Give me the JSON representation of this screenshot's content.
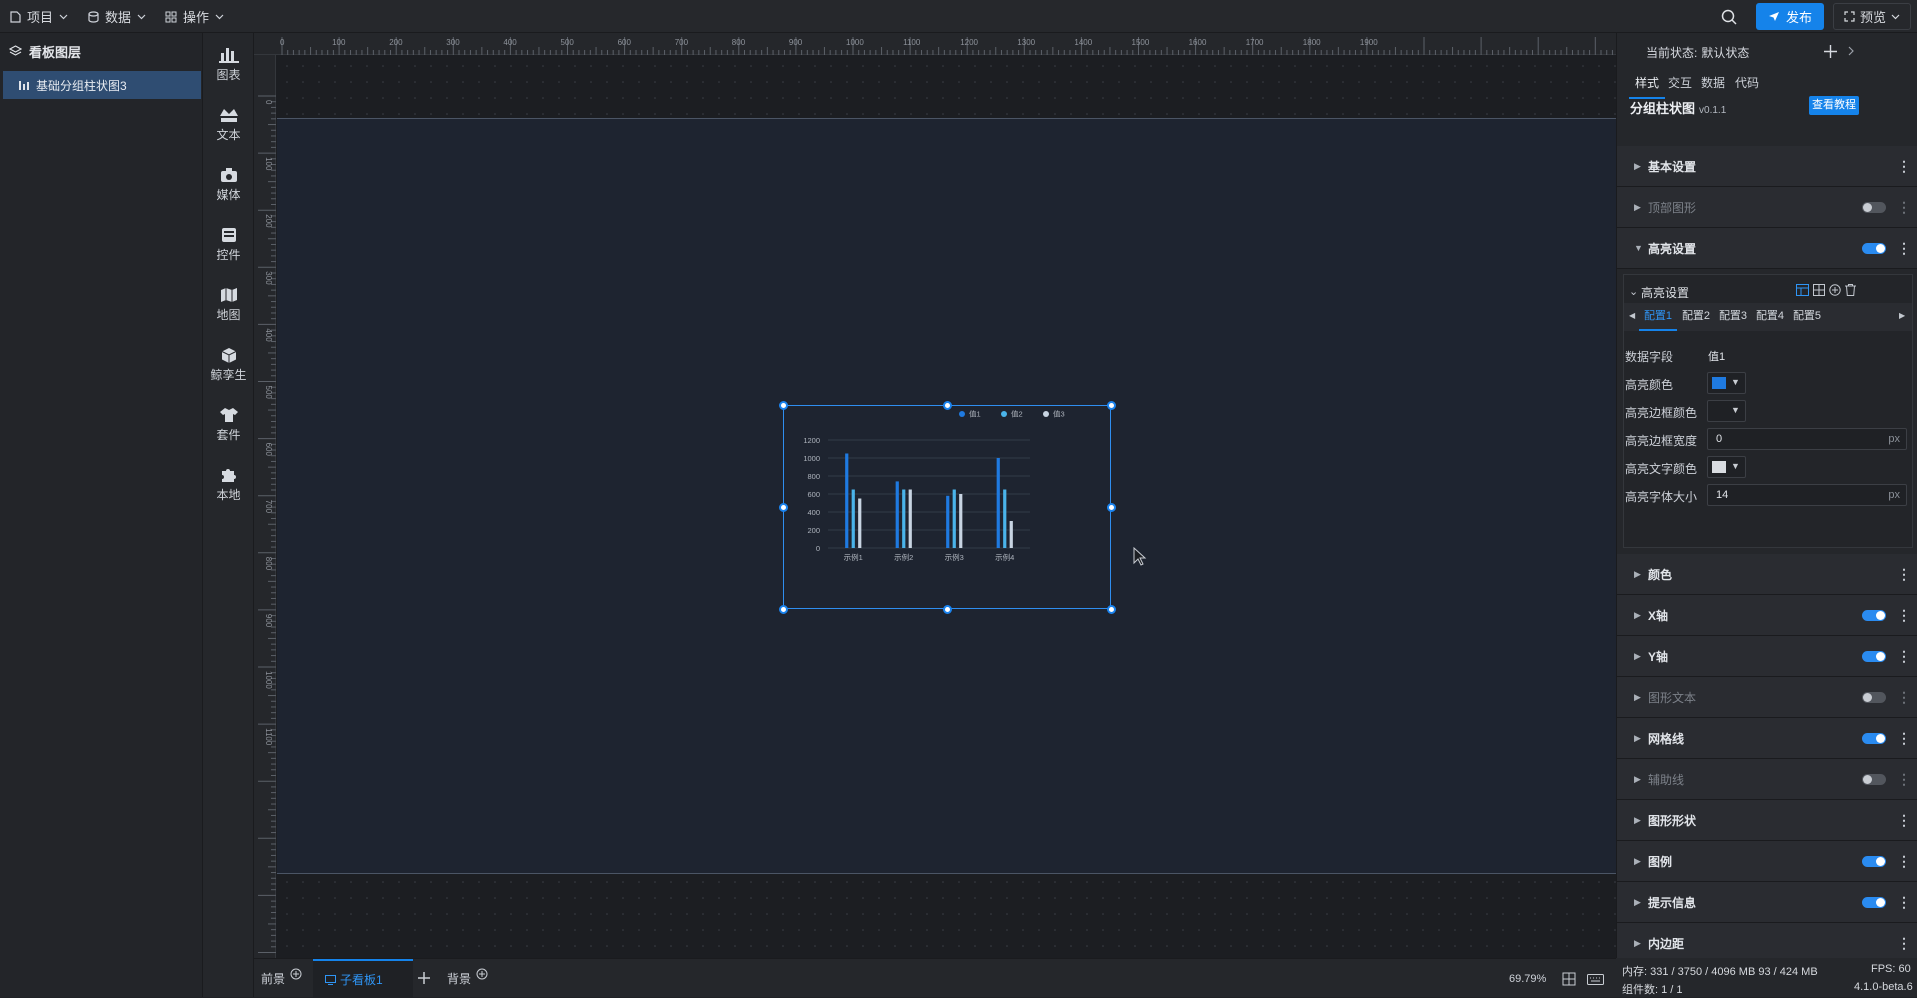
{
  "topbar": {
    "menus": [
      {
        "label": "项目",
        "icon": "file-icon"
      },
      {
        "label": "数据",
        "icon": "database-icon"
      },
      {
        "label": "操作",
        "icon": "grid-icon"
      }
    ],
    "publish_label": "发布",
    "preview_label": "预览"
  },
  "layers": {
    "title": "看板图层",
    "item": "基础分组柱状图3"
  },
  "components": [
    "图表",
    "文本",
    "媒体",
    "控件",
    "地图",
    "鲸孪生",
    "套件",
    "本地"
  ],
  "ruler": {
    "top": [
      "0",
      "100",
      "200",
      "300",
      "400",
      "500",
      "600",
      "700",
      "800",
      "900",
      "1000",
      "1100",
      "1200",
      "1300",
      "1400",
      "1500",
      "1600",
      "1700",
      "1800",
      "1900"
    ],
    "left": [
      "0",
      "100",
      "200",
      "300",
      "400",
      "500",
      "600",
      "700",
      "800",
      "900",
      "1000",
      "1100"
    ]
  },
  "chart_data": {
    "type": "bar",
    "categories": [
      "示例1",
      "示例2",
      "示例3",
      "示例4"
    ],
    "series": [
      {
        "name": "值1",
        "values": [
          1050,
          740,
          580,
          1000
        ],
        "color": "#1f7ae0"
      },
      {
        "name": "值2",
        "values": [
          650,
          650,
          650,
          650
        ],
        "color": "#4ab4ea"
      },
      {
        "name": "值3",
        "values": [
          550,
          650,
          600,
          300
        ],
        "color": "#c8d4e2"
      }
    ],
    "yticks": [
      "0",
      "200",
      "400",
      "600",
      "800",
      "1000",
      "1200"
    ],
    "ylim": [
      0,
      1200
    ],
    "legend": "top-right",
    "grid": true
  },
  "bottom": {
    "tab_front": "前景",
    "tab_board": "子看板1",
    "tab_back": "背景",
    "zoom": "69.79%"
  },
  "panel": {
    "state_label": "当前状态:",
    "state_value": "默认状态",
    "tabs": [
      "样式",
      "交互",
      "数据",
      "代码"
    ],
    "component_name": "分组柱状图",
    "version": "v0.1.1",
    "tutorial_button": "查看教程",
    "sections_top": [
      {
        "label": "基本设置",
        "toggle": null,
        "dim": false,
        "open": false
      },
      {
        "label": "顶部图形",
        "toggle": false,
        "dim": true,
        "open": false
      },
      {
        "label": "高亮设置",
        "toggle": true,
        "dim": false,
        "open": true
      }
    ],
    "highlight": {
      "title": "高亮设置",
      "configs": [
        "配置1",
        "配置2",
        "配置3",
        "配置4",
        "配置5"
      ],
      "fields": {
        "data_field_label": "数据字段",
        "data_field_value": "值1",
        "color_label": "高亮颜色",
        "color_value": "#1f7ae0",
        "border_color_label": "高亮边框颜色",
        "border_width_label": "高亮边框宽度",
        "border_width_value": "0",
        "text_color_label": "高亮文字颜色",
        "text_color_value": "#d9dce1",
        "font_size_label": "高亮字体大小",
        "font_size_value": "14",
        "unit": "px"
      }
    },
    "sections_bottom": [
      {
        "label": "颜色",
        "toggle": null,
        "dim": false
      },
      {
        "label": "X轴",
        "toggle": true,
        "dim": false
      },
      {
        "label": "Y轴",
        "toggle": true,
        "dim": false
      },
      {
        "label": "图形文本",
        "toggle": false,
        "dim": true
      },
      {
        "label": "网格线",
        "toggle": true,
        "dim": false
      },
      {
        "label": "辅助线",
        "toggle": false,
        "dim": true
      },
      {
        "label": "图形形状",
        "toggle": null,
        "dim": false
      },
      {
        "label": "图例",
        "toggle": true,
        "dim": false
      },
      {
        "label": "提示信息",
        "toggle": true,
        "dim": false
      },
      {
        "label": "内边距",
        "toggle": null,
        "dim": false
      }
    ]
  },
  "status": {
    "memory": "内存: 331 / 3750 / 4096 MB  93 / 424 MB",
    "fps": "FPS: 60",
    "components": "组件数: 1 / 1",
    "version": "4.1.0-beta.6"
  }
}
